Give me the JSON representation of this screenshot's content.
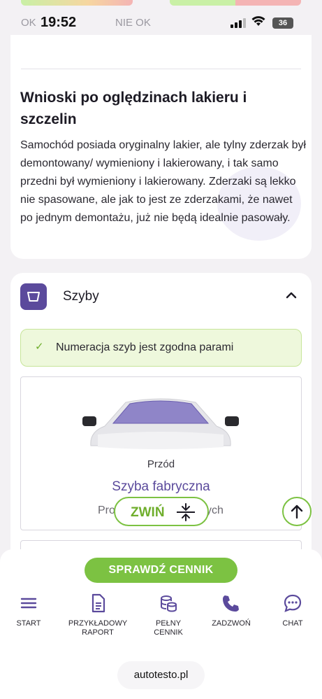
{
  "status_bar": {
    "ok_label": "OK",
    "time": "19:52",
    "not_ok_label": "NIE OK",
    "battery": "36"
  },
  "conclusions": {
    "title": "Wnioski po oględzinach lakieru i szczelin",
    "body": "Samochód posiada oryginalny lakier, ale tylny zderzak był demontowany/ wymieniony i lakierowany, i tak samo przedni był wymieniony i lakierowany. Zderzaki są lekko nie spasowane, ale jak to jest ze zderzakami, że nawet po jednym demontażu, już nie będą idealnie pasowały."
  },
  "windows_section": {
    "icon": "windshield-icon",
    "title": "Szyby",
    "notice": "Numeracja szyb jest zgodna parami",
    "glass": {
      "side": "Przód",
      "result": "Szyba fabryczna",
      "sub_left": "Pro",
      "sub_right": "ych"
    }
  },
  "floating": {
    "collapse_label": "ZWIŃ"
  },
  "bottom_bar": {
    "cta": "SPRAWDŹ CENNIK",
    "nav": [
      {
        "label": "START",
        "icon": "menu-icon"
      },
      {
        "label": "PRZYKŁADOWY RAPORT",
        "icon": "document-icon"
      },
      {
        "label": "PEŁNY CENNIK",
        "icon": "coins-icon"
      },
      {
        "label": "ZADZWOŃ",
        "icon": "phone-icon"
      },
      {
        "label": "CHAT",
        "icon": "chat-icon"
      }
    ]
  },
  "browser": {
    "url": "autotesto.pl"
  },
  "colors": {
    "accent_purple": "#5b4a9c",
    "accent_green": "#7cc242"
  }
}
